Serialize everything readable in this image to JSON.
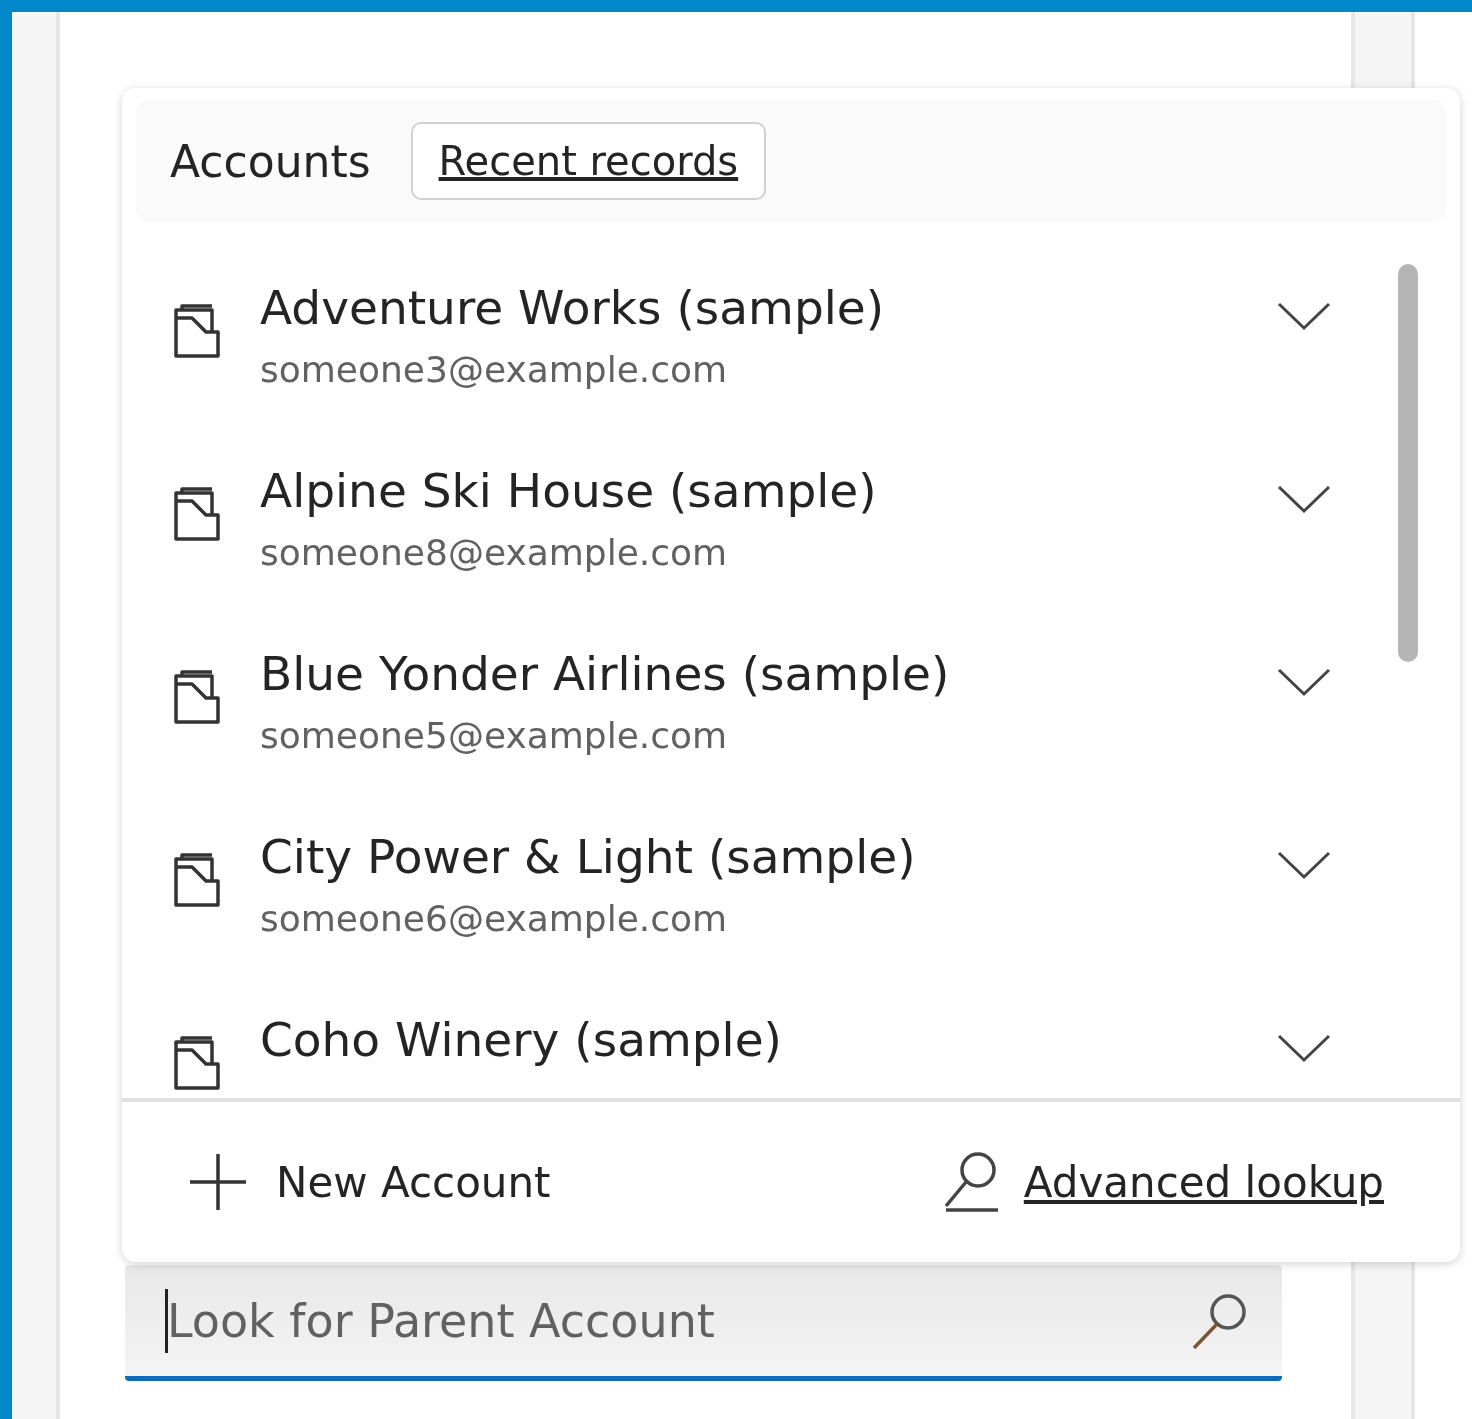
{
  "tabs": [
    {
      "label": "Accounts",
      "selected": true
    },
    {
      "label": "Recent records",
      "selected": false
    }
  ],
  "records": [
    {
      "name": "Adventure Works (sample)",
      "email": "someone3@example.com"
    },
    {
      "name": "Alpine Ski House (sample)",
      "email": "someone8@example.com"
    },
    {
      "name": "Blue Yonder Airlines (sample)",
      "email": "someone5@example.com"
    },
    {
      "name": "City Power & Light (sample)",
      "email": "someone6@example.com"
    },
    {
      "name": "Coho Winery (sample)"
    }
  ],
  "footer": {
    "new_button": "New Account",
    "advanced_link": "Advanced lookup"
  },
  "search": {
    "placeholder": "Look for Parent Account",
    "focused": true
  }
}
